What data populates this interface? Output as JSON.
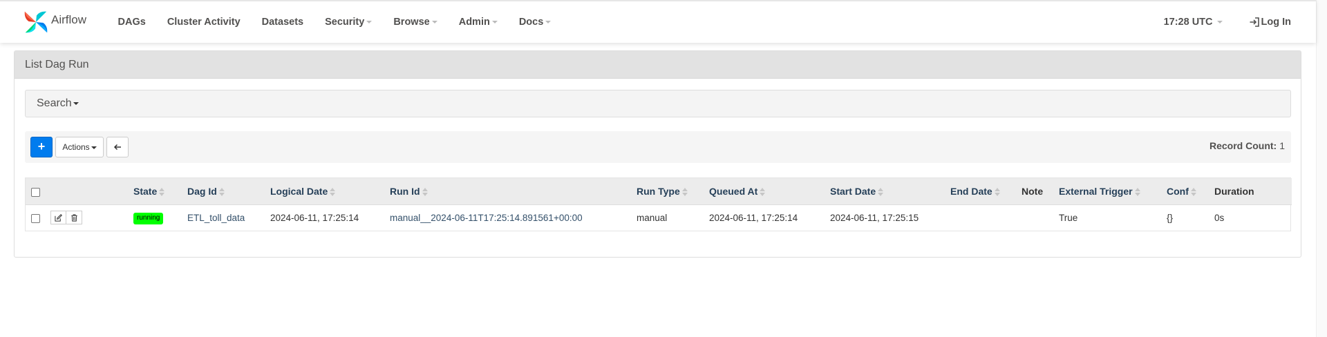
{
  "navbar": {
    "brand": "Airflow",
    "menu": [
      {
        "label": "DAGs",
        "dropdown": false
      },
      {
        "label": "Cluster Activity",
        "dropdown": false
      },
      {
        "label": "Datasets",
        "dropdown": false
      },
      {
        "label": "Security",
        "dropdown": true
      },
      {
        "label": "Browse",
        "dropdown": true
      },
      {
        "label": "Admin",
        "dropdown": true
      },
      {
        "label": "Docs",
        "dropdown": true
      }
    ],
    "time": "17:28 UTC",
    "login": "Log In"
  },
  "panel": {
    "title": "List Dag Run",
    "search_label": "Search",
    "actions_label": "Actions",
    "add_label": "+",
    "record_count_label": "Record Count:",
    "record_count": "1"
  },
  "table": {
    "headers": [
      "State",
      "Dag Id",
      "Logical Date",
      "Run Id",
      "Run Type",
      "Queued At",
      "Start Date",
      "End Date",
      "Note",
      "External Trigger",
      "Conf",
      "Duration"
    ],
    "rows": [
      {
        "state": "running",
        "dag_id": "ETL_toll_data",
        "logical_date": "2024-06-11, 17:25:14",
        "run_id": "manual__2024-06-11T17:25:14.891561+00:00",
        "run_type": "manual",
        "queued_at": "2024-06-11, 17:25:14",
        "start_date": "2024-06-11, 17:25:15",
        "end_date": "",
        "note": "",
        "external_trigger": "True",
        "conf": "{}",
        "duration": "0s"
      }
    ]
  },
  "colors": {
    "primary": "#017cee",
    "state_running": "#00ff00",
    "header_text": "#253f58",
    "panel_heading_bg": "#e2e2e2"
  }
}
